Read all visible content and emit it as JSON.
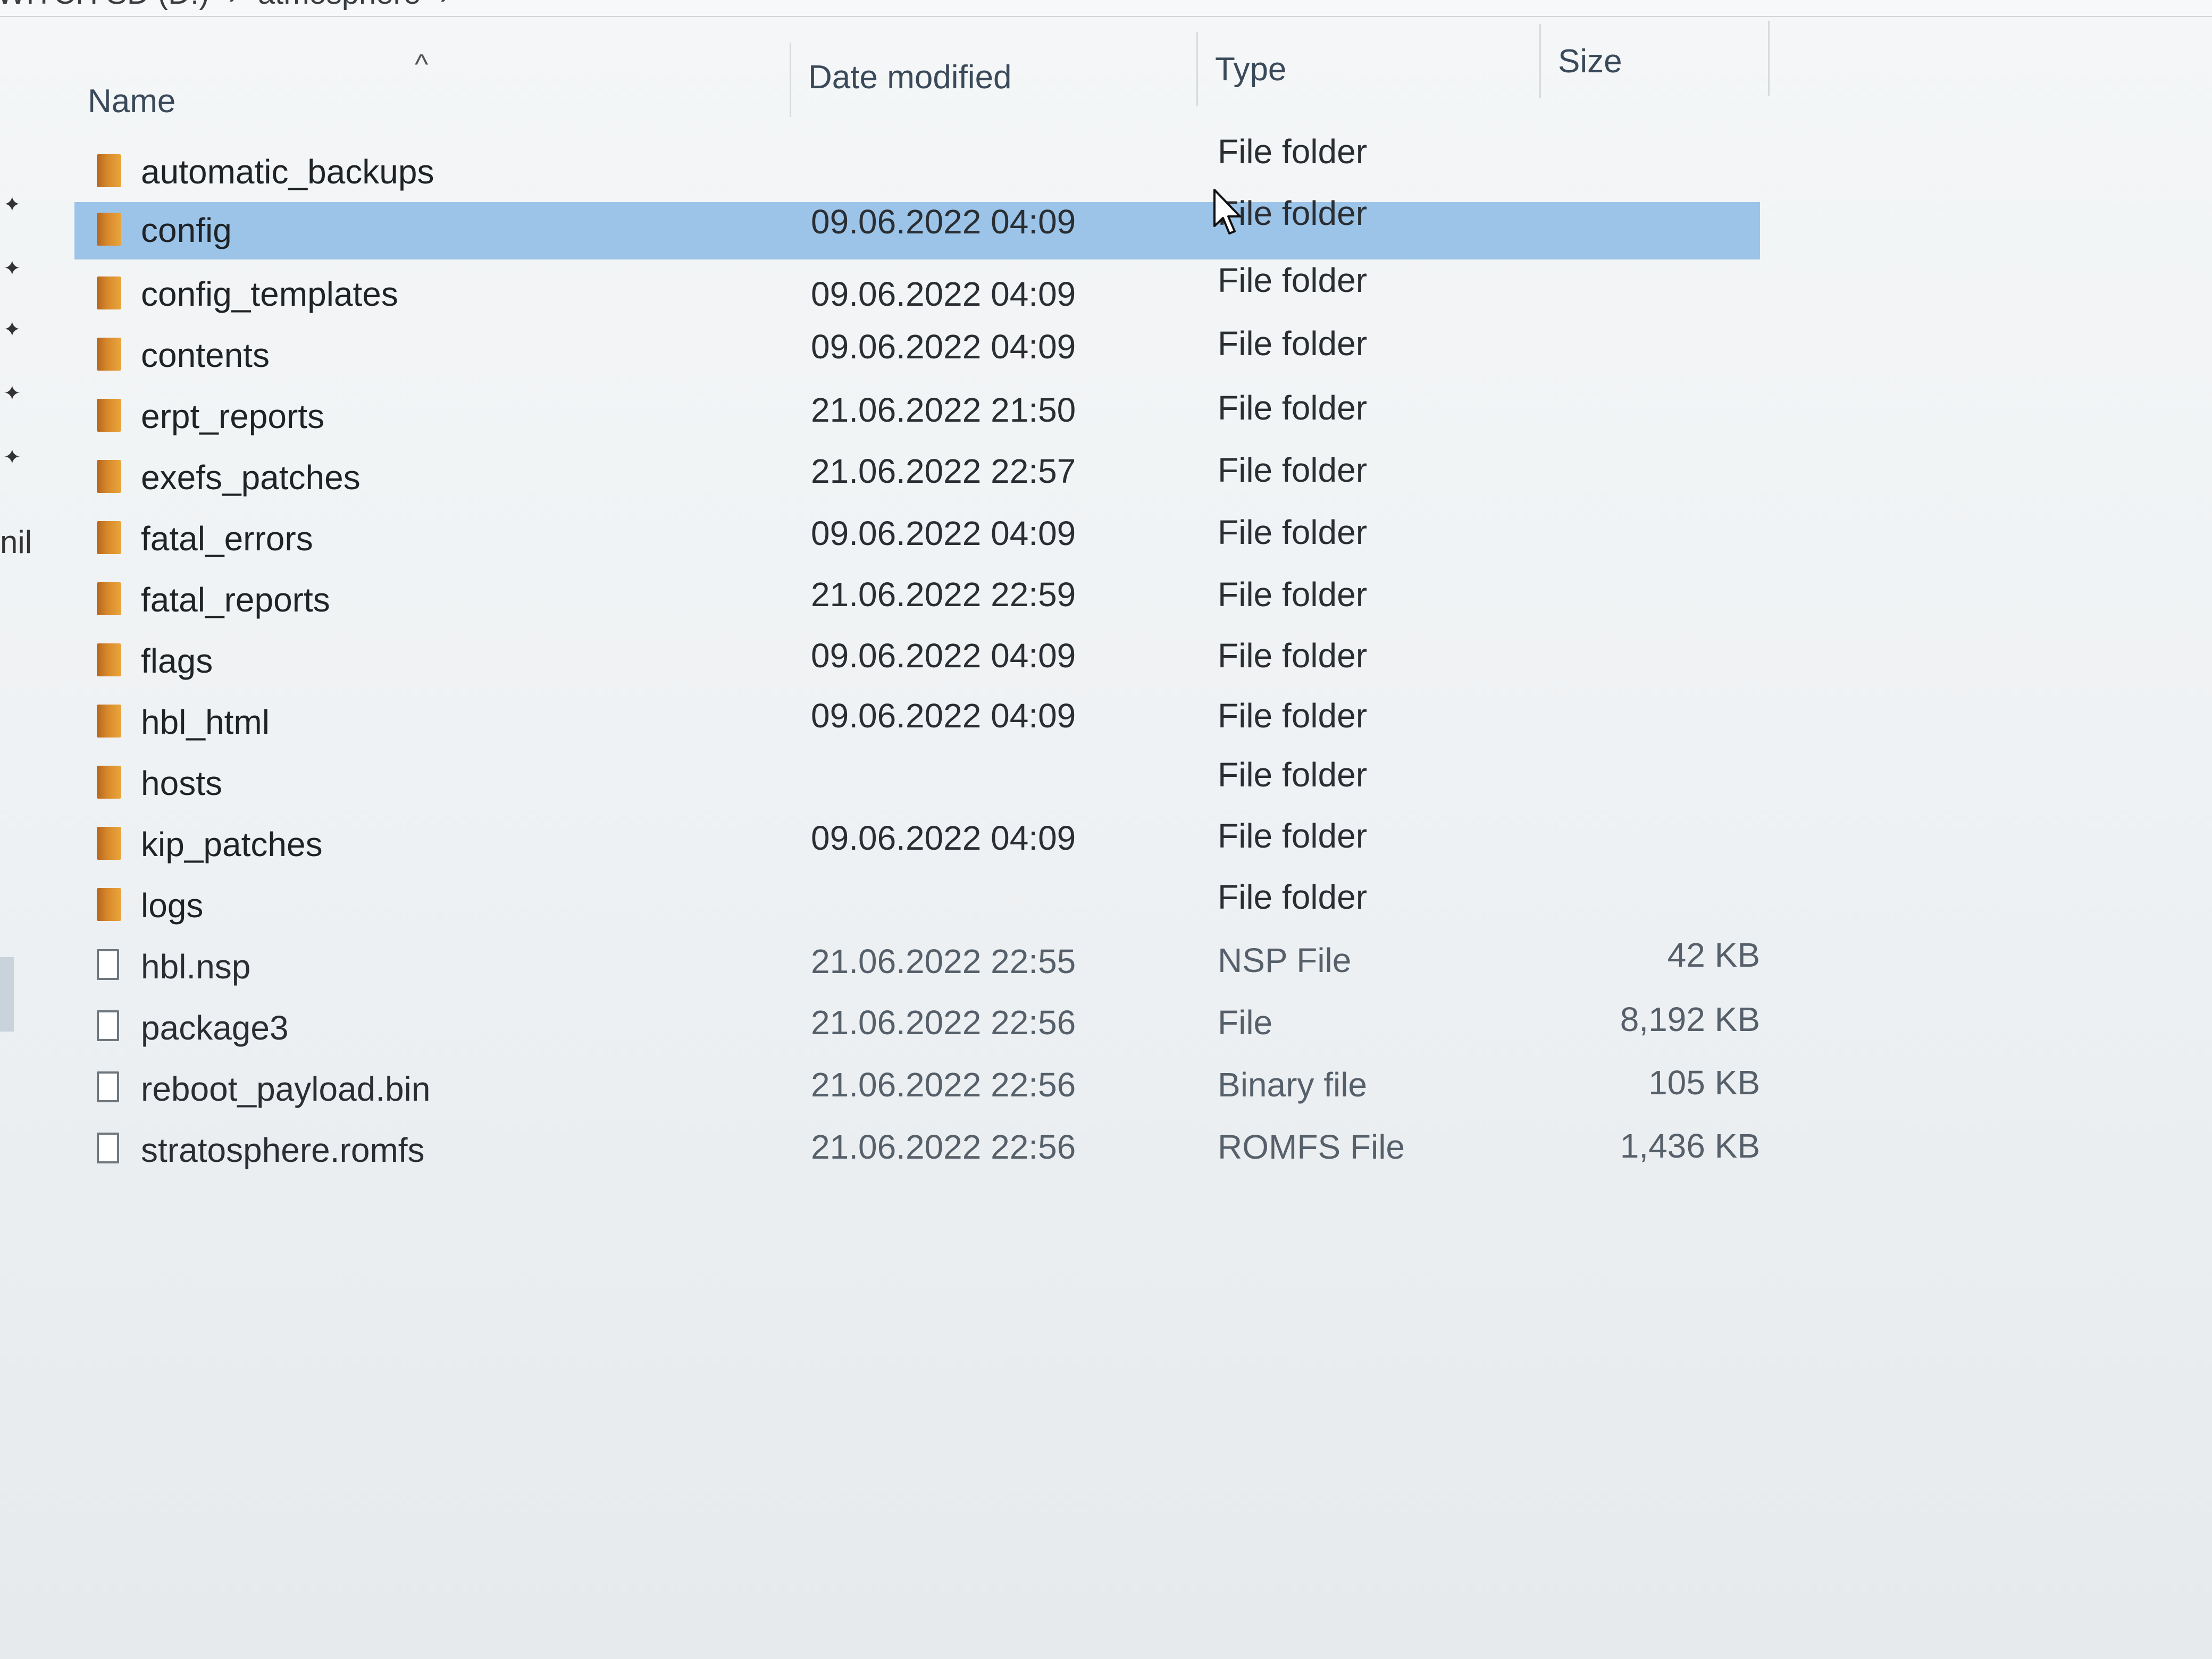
{
  "window": {
    "breadcrumb": [
      "WITCH SD (D:)",
      "›",
      "atmosphere",
      "›"
    ]
  },
  "navpane": {
    "partial_label": "nil"
  },
  "columns": {
    "name": "Name",
    "date": "Date modified",
    "type": "Type",
    "size": "Size"
  },
  "rows": [
    {
      "name": "automatic_backups",
      "date": "",
      "type": "File folder",
      "size": "",
      "kind": "folder"
    },
    {
      "name": "config",
      "date": "09.06.2022 04:09",
      "type": "File folder",
      "size": "",
      "kind": "folder",
      "selected": true
    },
    {
      "name": "config_templates",
      "date": "09.06.2022 04:09",
      "type": "File folder",
      "size": "",
      "kind": "folder"
    },
    {
      "name": "contents",
      "date": "09.06.2022 04:09",
      "type": "File folder",
      "size": "",
      "kind": "folder"
    },
    {
      "name": "erpt_reports",
      "date": "21.06.2022 21:50",
      "type": "File folder",
      "size": "",
      "kind": "folder"
    },
    {
      "name": "exefs_patches",
      "date": "21.06.2022 22:57",
      "type": "File folder",
      "size": "",
      "kind": "folder"
    },
    {
      "name": "fatal_errors",
      "date": "09.06.2022 04:09",
      "type": "File folder",
      "size": "",
      "kind": "folder"
    },
    {
      "name": "fatal_reports",
      "date": "21.06.2022 22:59",
      "type": "File folder",
      "size": "",
      "kind": "folder"
    },
    {
      "name": "flags",
      "date": "09.06.2022 04:09",
      "type": "File folder",
      "size": "",
      "kind": "folder"
    },
    {
      "name": "hbl_html",
      "date": "09.06.2022 04:09",
      "type": "File folder",
      "size": "",
      "kind": "folder"
    },
    {
      "name": "hosts",
      "date": "",
      "type": "File folder",
      "size": "",
      "kind": "folder"
    },
    {
      "name": "kip_patches",
      "date": "09.06.2022 04:09",
      "type": "File folder",
      "size": "",
      "kind": "folder"
    },
    {
      "name": "logs",
      "date": "",
      "type": "File folder",
      "size": "",
      "kind": "folder"
    },
    {
      "name": "hbl.nsp",
      "date": "21.06.2022 22:55",
      "type": "NSP File",
      "size": "42 KB",
      "kind": "file"
    },
    {
      "name": "package3",
      "date": "21.06.2022 22:56",
      "type": "File",
      "size": "8,192 KB",
      "kind": "file"
    },
    {
      "name": "reboot_payload.bin",
      "date": "21.06.2022 22:56",
      "type": "Binary file",
      "size": "105 KB",
      "kind": "file"
    },
    {
      "name": "stratosphere.romfs",
      "date": "21.06.2022 22:56",
      "type": "ROMFS File",
      "size": "1,436 KB",
      "kind": "file"
    }
  ],
  "colors": {
    "selection": "#9cc4e8",
    "folder": "#d98a2b",
    "header_text": "#3b4a5a"
  },
  "icons": {
    "folder": "folder-icon",
    "file": "file-icon",
    "sort": "sort-ascending-icon",
    "pin": "pin-icon",
    "cursor": "mouse-cursor-icon"
  }
}
